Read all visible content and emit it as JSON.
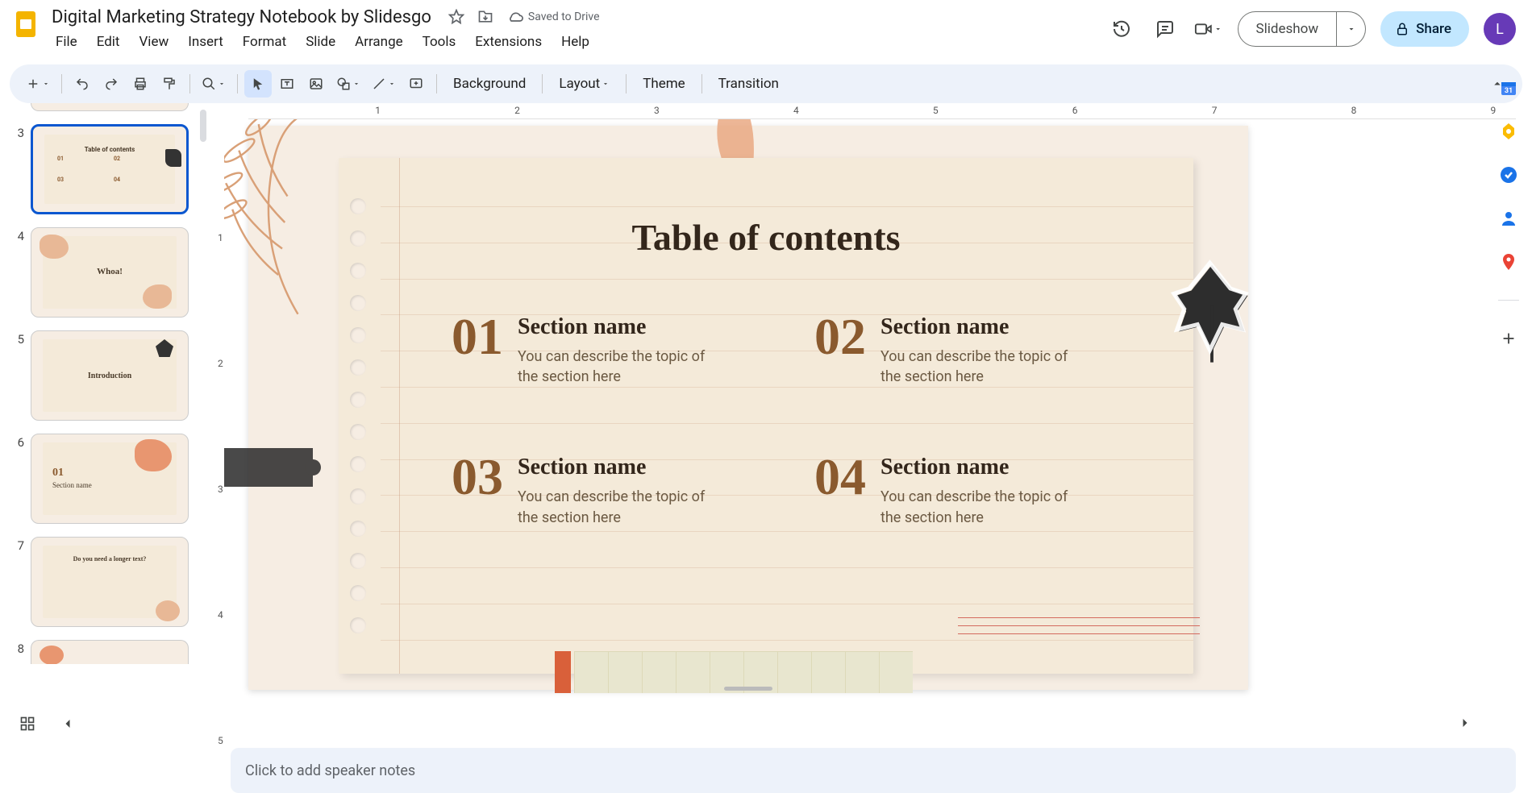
{
  "header": {
    "doc_title": "Digital Marketing Strategy Notebook by Slidesgo",
    "saved_status": "Saved to Drive",
    "menu": [
      "File",
      "Edit",
      "View",
      "Insert",
      "Format",
      "Slide",
      "Arrange",
      "Tools",
      "Extensions",
      "Help"
    ],
    "slideshow_label": "Slideshow",
    "share_label": "Share",
    "avatar_initial": "L"
  },
  "toolbar": {
    "background_label": "Background",
    "layout_label": "Layout",
    "theme_label": "Theme",
    "transition_label": "Transition"
  },
  "ruler_marks_h": [
    "1",
    "2",
    "3",
    "4",
    "5",
    "6",
    "7",
    "8",
    "9"
  ],
  "ruler_marks_v": [
    "1",
    "2",
    "3",
    "4",
    "5"
  ],
  "thumbnails": [
    {
      "num": "3",
      "selected": true,
      "title": "Table of contents"
    },
    {
      "num": "4",
      "selected": false,
      "title": "Whoa!"
    },
    {
      "num": "5",
      "selected": false,
      "title": "Introduction"
    },
    {
      "num": "6",
      "selected": false,
      "title": "01 Section name"
    },
    {
      "num": "7",
      "selected": false,
      "title": "Do you need a longer text?"
    },
    {
      "num": "8",
      "selected": false,
      "title": ""
    }
  ],
  "slide": {
    "title": "Table of contents",
    "items": [
      {
        "num": "01",
        "name": "Section name",
        "desc": "You can describe the topic of the section here"
      },
      {
        "num": "02",
        "name": "Section name",
        "desc": "You can describe the topic of the section here"
      },
      {
        "num": "03",
        "name": "Section name",
        "desc": "You can describe the topic of the section here"
      },
      {
        "num": "04",
        "name": "Section name",
        "desc": "You can describe the topic of the section here"
      }
    ]
  },
  "notes": {
    "placeholder": "Click to add speaker notes"
  }
}
